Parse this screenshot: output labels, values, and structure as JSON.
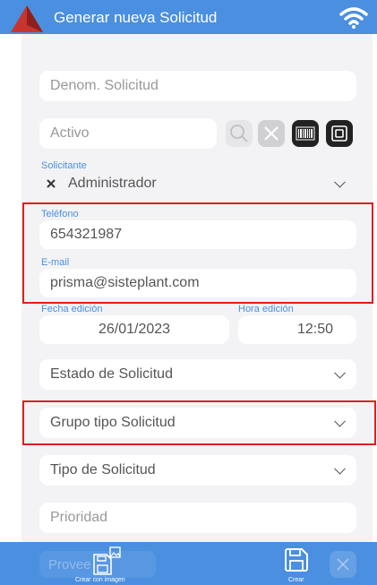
{
  "app": {
    "title": "Generar nueva Solicitud"
  },
  "form": {
    "denom": {
      "placeholder": "Denom. Solicitud"
    },
    "activo": {
      "placeholder": "Activo"
    },
    "solicitante": {
      "label": "Solicitante",
      "value": "Administrador"
    },
    "telefono": {
      "label": "Teléfono",
      "value": "654321987"
    },
    "email": {
      "label": "E-mail",
      "value": "prisma@sisteplant.com"
    },
    "fecha": {
      "label": "Fecha edición",
      "value": "26/01/2023"
    },
    "hora": {
      "label": "Hora edición",
      "value": "12:50"
    },
    "estado": {
      "placeholder": "Estado de Solicitud"
    },
    "grupo": {
      "placeholder": "Grupo tipo Solicitud"
    },
    "tipo": {
      "placeholder": "Tipo de Solicitud"
    },
    "prioridad": {
      "placeholder": "Prioridad"
    },
    "proveedor": {
      "placeholder": "Provee"
    }
  },
  "bottom": {
    "crear_con_imagen": "Crear con imagen",
    "crear": "Crear"
  },
  "colors": {
    "accent": "#4a8fe0",
    "highlight": "#e01e1e"
  }
}
